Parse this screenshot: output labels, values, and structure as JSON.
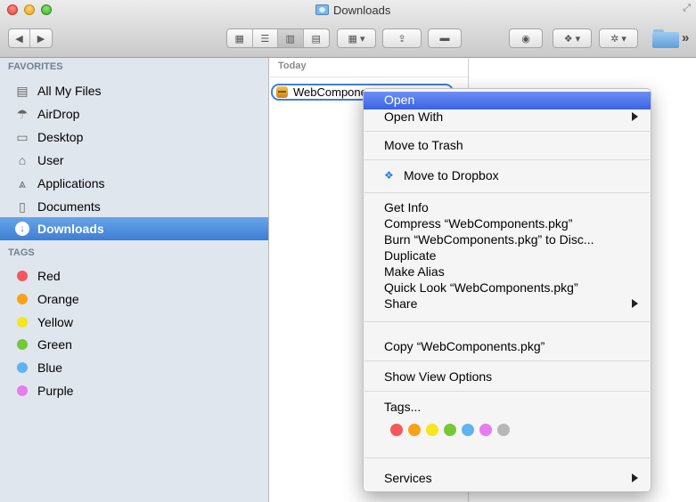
{
  "window": {
    "title": "Downloads"
  },
  "sidebar": {
    "favorites_heading": "FAVORITES",
    "favorites": [
      {
        "label": "All My Files",
        "icon": "all-my-files-icon"
      },
      {
        "label": "AirDrop",
        "icon": "airdrop-icon"
      },
      {
        "label": "Desktop",
        "icon": "desktop-icon"
      },
      {
        "label": "User",
        "icon": "home-icon"
      },
      {
        "label": "Applications",
        "icon": "applications-icon"
      },
      {
        "label": "Documents",
        "icon": "documents-icon"
      },
      {
        "label": "Downloads",
        "icon": "downloads-icon",
        "selected": true
      }
    ],
    "tags_heading": "TAGS",
    "tags": [
      {
        "label": "Red",
        "color": "#f4585d"
      },
      {
        "label": "Orange",
        "color": "#f8a21a"
      },
      {
        "label": "Yellow",
        "color": "#f7e51e"
      },
      {
        "label": "Green",
        "color": "#77c834"
      },
      {
        "label": "Blue",
        "color": "#5fb3f0"
      },
      {
        "label": "Purple",
        "color": "#e77cf0"
      }
    ]
  },
  "browser": {
    "column_heading": "Today",
    "file_name": "WebCompone"
  },
  "context_menu": {
    "items": [
      {
        "label": "Open"
      },
      {
        "label": "Open With"
      },
      {
        "label": "Move to Trash"
      },
      {
        "label": "Move to Dropbox",
        "icon": "dropbox-icon"
      },
      {
        "label": "Get Info"
      },
      {
        "label": "Compress “WebComponents.pkg”"
      },
      {
        "label": "Burn “WebComponents.pkg” to Disc..."
      },
      {
        "label": "Duplicate"
      },
      {
        "label": "Make Alias"
      },
      {
        "label": "Quick Look “WebComponents.pkg”"
      },
      {
        "label": "Share"
      },
      {
        "label": "Copy “WebComponents.pkg”"
      },
      {
        "label": "Show View Options"
      },
      {
        "label": "Tags..."
      },
      {
        "label": "Services"
      }
    ],
    "tag_colors": [
      "#f4585d",
      "#f8a21a",
      "#f7e51e",
      "#77c834",
      "#5fb3f0",
      "#e77cf0",
      "#b7b7b7"
    ]
  },
  "colors": {
    "accent": "#3d7fd6",
    "menu_highlight": "#3a62e4"
  }
}
